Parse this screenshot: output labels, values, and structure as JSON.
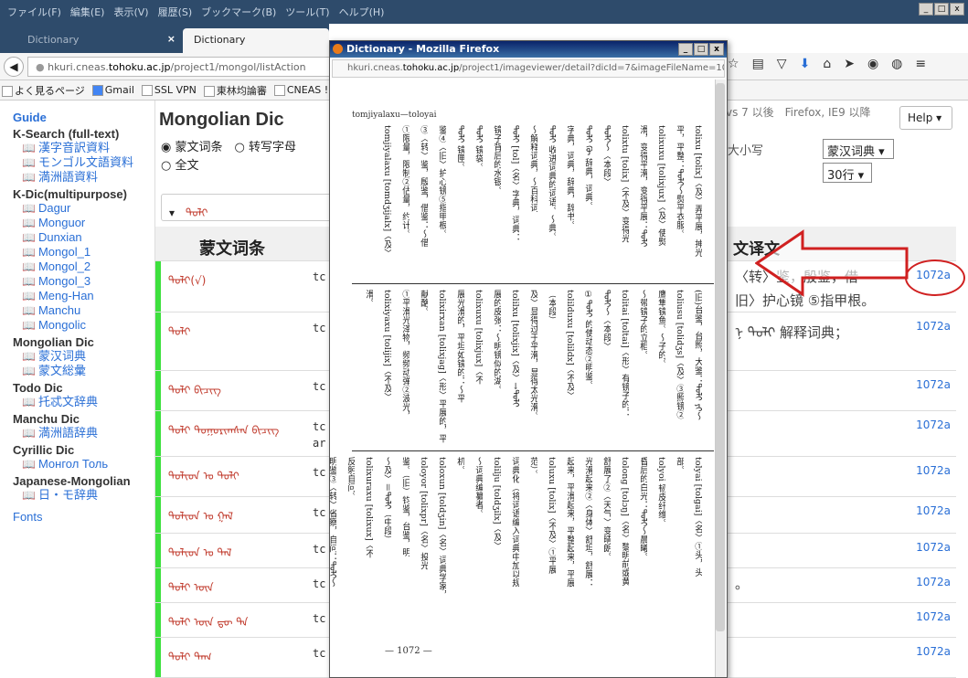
{
  "menubar": {
    "items": [
      "ファイル(F)",
      "編集(E)",
      "表示(V)",
      "履歴(S)",
      "ブックマーク(B)",
      "ツール(T)",
      "ヘルプ(H)"
    ]
  },
  "tabs": [
    {
      "label": "Dictionary",
      "close": "×"
    },
    {
      "label": "Dictionary"
    }
  ],
  "nav": {
    "url_prefix": "hkuri.cneas.",
    "url_domain": "tohoku.ac.jp",
    "url_path": "/project1/mongol/listAction"
  },
  "bookmarks": [
    "よく見るページ",
    "Gmail",
    "SSL VPN",
    "東林均論審",
    "CNEAS ! w"
  ],
  "sidebar": {
    "sections": [
      {
        "title": "Guide",
        "link": true,
        "items": []
      },
      {
        "title": "K-Search (full-text)",
        "items": [
          "漢字音訳資料",
          "モンゴル文語資料",
          "満洲語資料"
        ]
      },
      {
        "title": "K-Dic(multipurpose)",
        "items": [
          "Dagur",
          "Monguor",
          "Dunxian",
          "Mongol_1",
          "Mongol_2",
          "Mongol_3",
          "Meng-Han",
          "Manchu",
          "Mongolic"
        ]
      },
      {
        "title": "Mongolian Dic",
        "items": [
          "蒙汉词典",
          "蒙文総彙"
        ]
      },
      {
        "title": "Todo Dic",
        "items": [
          "托忒文辞典"
        ]
      },
      {
        "title": "Manchu Dic",
        "items": [
          "満洲語辞典"
        ]
      },
      {
        "title": "Cyrillic Dic",
        "items": [
          "Монгол Толь"
        ]
      },
      {
        "title": "Japanese-Mongolian",
        "items": [
          "日・モ辞典"
        ]
      },
      {
        "title": "Fonts",
        "link": true,
        "items": []
      }
    ]
  },
  "main": {
    "heading": "Mongolian Dic",
    "radio1": "蒙文词条",
    "radio2": "转写字母",
    "radio3": "全文",
    "search_value": "ᠲᠣᠯᠢ",
    "col_header": "蒙文词条",
    "rows": [
      {
        "mongol": "ᠲᠣᠯᠢ(√)",
        "translit": "tc",
        "mark": true
      },
      {
        "mongol": "ᠲᠣᠯᠢ",
        "translit": "tc",
        "mark": true
      },
      {
        "mongol": "ᠲᠣᠯᠢ ᠪᠢᠴᠢᠭ",
        "translit": "tc",
        "mark": true
      },
      {
        "mongol": "ᠲᠣᠯᠢ ᠲᠣᠭᠤᠷᠢᠭᠰᠠᠨ ᠪᠢᠴᠢᠭ",
        "translit": "tc",
        "translit2": "ar",
        "mark": true
      },
      {
        "mongol": "ᠲᠣᠯᠢᠳ ᠤ ᠲᠣᠯᠢ",
        "translit": "tc",
        "mark": true
      },
      {
        "mongol": "ᠲᠣᠯᠢᠳ ᠤ ᠭᠠᠯ",
        "translit": "tc",
        "mark": true
      },
      {
        "mongol": "ᠲᠣᠯᠢᠳ ᠤ ᠲᠠᠯ",
        "translit": "tc",
        "mark": true
      },
      {
        "mongol": "ᠲᠣᠯᠢ ᠦᠨ",
        "translit": "tc",
        "mark": true
      },
      {
        "mongol": "ᠲᠣᠯᠢ ᠦᠨ ᠳᠦ ᠲᠠ",
        "translit": "tc",
        "mark": true
      },
      {
        "mongol": "ᠲᠣᠯᠢ ᠳᠠᠭ",
        "translit": "tc",
        "mark": true
      }
    ]
  },
  "right": {
    "info": "vs 7 以後　Firefox, IE9 以降",
    "help": "Help ▾",
    "small": "大小写",
    "dict_select": "蒙汉词典 ▾",
    "rows_select": "30行 ▾",
    "col_header": "文译文",
    "rows": [
      {
        "text": "〈转〉鉴，殷鉴，借",
        "text2": "旧〉护心镜 ⑤指甲根。",
        "page": "1072a"
      },
      {
        "text": "ᠨ ᠲᠣᠯᠢ 解释词典；",
        "page": "1072a"
      },
      {
        "text": "",
        "page": "1072a"
      },
      {
        "text": "",
        "page": "1072a"
      },
      {
        "text": "",
        "page": "1072a"
      },
      {
        "text": "",
        "page": "1072a"
      },
      {
        "text": "",
        "page": "1072a"
      },
      {
        "text": "。",
        "page": "1072a"
      },
      {
        "text": "",
        "page": "1072a"
      },
      {
        "text": "",
        "page": "1072a"
      }
    ]
  },
  "popup": {
    "title": "Dictionary - Mozilla Firefox",
    "url_prefix": "hkuri.cneas.",
    "url_domain": "tohoku.ac.jp",
    "url_path": "/project1/imageviewer/detail?dicId=7&imageFileName=1072",
    "page_header": "tomjiyalaxu—toloyai",
    "page_number": "— 1072 —",
    "columns_top": [
      "tolixu [tolix]〈及〉弄平展，抻光",
      "平，平整：ᠲᠣᠯᠢ～熨平衣服。",
      "tolixuxu [tolixjux]〈及〉使熨",
      "滑，变得平滑，变得平展：ᠲᠣᠯᠢ",
      "tolixtu [tolix]〈不及〉变得光",
      "ᠲᠣᠯᠢ～〈本段〉",
      "ᠲᠣᠯᠢ ᠬᠦ 辞典，词典。",
      "字典，词典，辞典，辞书。",
      "ᠲᠣᠯᠢ 收进词典的词语。～典。",
      "～解释词典，～百科词",
      "ᠲᠣᠯᠢ [tol]〈名〉字典，词典：",
      "镜子背后的水银。",
      "ᠲᠣᠯᠢ 镜袋。",
      "ᠲᠣᠯᠢ 镜匣。",
      "鉴④〈旧〉护心镜⑤指甲根。",
      "③〈转〉鉴，殷鉴，借鉴：～借",
      "①限量，限制②估量，约计。",
      "tomjiyalaxu [tomdʒijalx]〈及〉"
    ],
    "columns_mid": [
      "(旧)台鉴，台照，大鉴：ᠲᠣᠯᠢ ᠶᠢ～",
      "toliusu [tolidʒs]〈及〉③照镜②",
      "鹰隼镜鱼。～子的。",
      "～带镜子的立柜。",
      "tolitai [toltai]〈形〉有镜子的：",
      "ᠲᠣᠯᠢ～〈本段〉",
      "①ᠲᠣᠯᠢ 的使动态②明鉴。",
      "tolilduxu [tolildx]〈不及〉",
      "（本段）",
      "及〉显得过于平滑，显得太光滑。",
      "tolilxu [tolixjix]〈及〉→ᠲᠣᠯᠢ",
      "展的皮张：～明镜似的湖。",
      "tolixuxu [tolixjux]〈不",
      "展光滑的，平坦如镜的：～平",
      "tolixirxan [tolixjag]〈形〉平展的，平",
      "献酪。",
      "①平滑光泽物，频频动弹②波光，",
      "tolixiyaxu [tolijix]〈不及〉",
      "滑。"
    ],
    "columns_bot": [
      "tolyai [tolgai]〈名〉①头，头",
      "部。",
      "tolyoi 韧皮纤维。",
      "昏后的白光：ᠲᠣᠯᠢ～晨曦。",
      "tolong [tolɔŋ]〈名〉黎明前或黄",
      "舒展了②〈天气〉变晴朗。",
      "光滑起来②〈身体〉舒坦，舒展：",
      "起来，平滑起来，平整起来，平展",
      "toluxu [tolix]〈不及〉①平展",
      "范）。",
      "词典化（将词语编入词典中加以规",
      "tolilju [toldʒilx]〈及〉",
      "～词典编纂者。",
      "机。",
      "toloxun [toldʒin]〈名〉词典学家，",
      "toloyor [tolixpr]〈名〉投光",
      "鉴。（旧）钧鉴，台鉴，明",
      "～及〉＝ᠲᠣᠯᠢ（中段）",
      "tolixuraxu [tolixux]〈不",
      "反躬自问。",
      "明鉴③〈转〉省察，自问：ᠲᠣᠯᠢ～"
    ]
  }
}
